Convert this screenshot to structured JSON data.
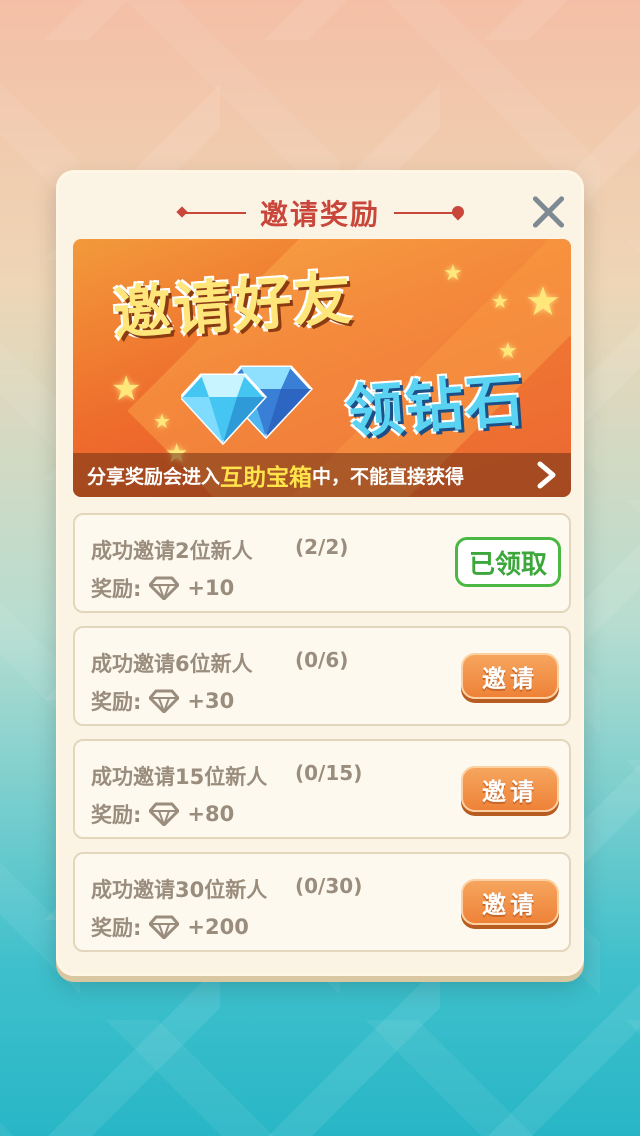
{
  "modal": {
    "title": "邀请奖励",
    "close_icon": "close-icon"
  },
  "banner": {
    "title": "邀请好友",
    "subtitle": "领钻石",
    "note_prefix": "分享奖励会进入",
    "note_highlight": "互助宝箱",
    "note_suffix": "中，不能直接获得",
    "arrow_icon": "chevron-right-icon",
    "colors": {
      "background": "#ee6c2c",
      "title": "#ffe67a",
      "subtitle": "#5ad3f3",
      "highlight": "#ffe34a"
    }
  },
  "reward_label": "奖励:",
  "tasks": [
    {
      "title": "成功邀请2位新人",
      "progress": "(2/2)",
      "reward": "+10",
      "button": "已领取",
      "state": "claimed"
    },
    {
      "title": "成功邀请6位新人",
      "progress": "(0/6)",
      "reward": "+30",
      "button": "邀请",
      "state": "invite"
    },
    {
      "title": "成功邀请15位新人",
      "progress": "(0/15)",
      "reward": "+80",
      "button": "邀请",
      "state": "invite"
    },
    {
      "title": "成功邀请30位新人",
      "progress": "(0/30)",
      "reward": "+200",
      "button": "邀请",
      "state": "invite"
    }
  ],
  "colors": {
    "title_red": "#c9463b",
    "invite_orange": "#ee8238",
    "claimed_green": "#4cb844",
    "muted_text": "#9a8d7d"
  }
}
